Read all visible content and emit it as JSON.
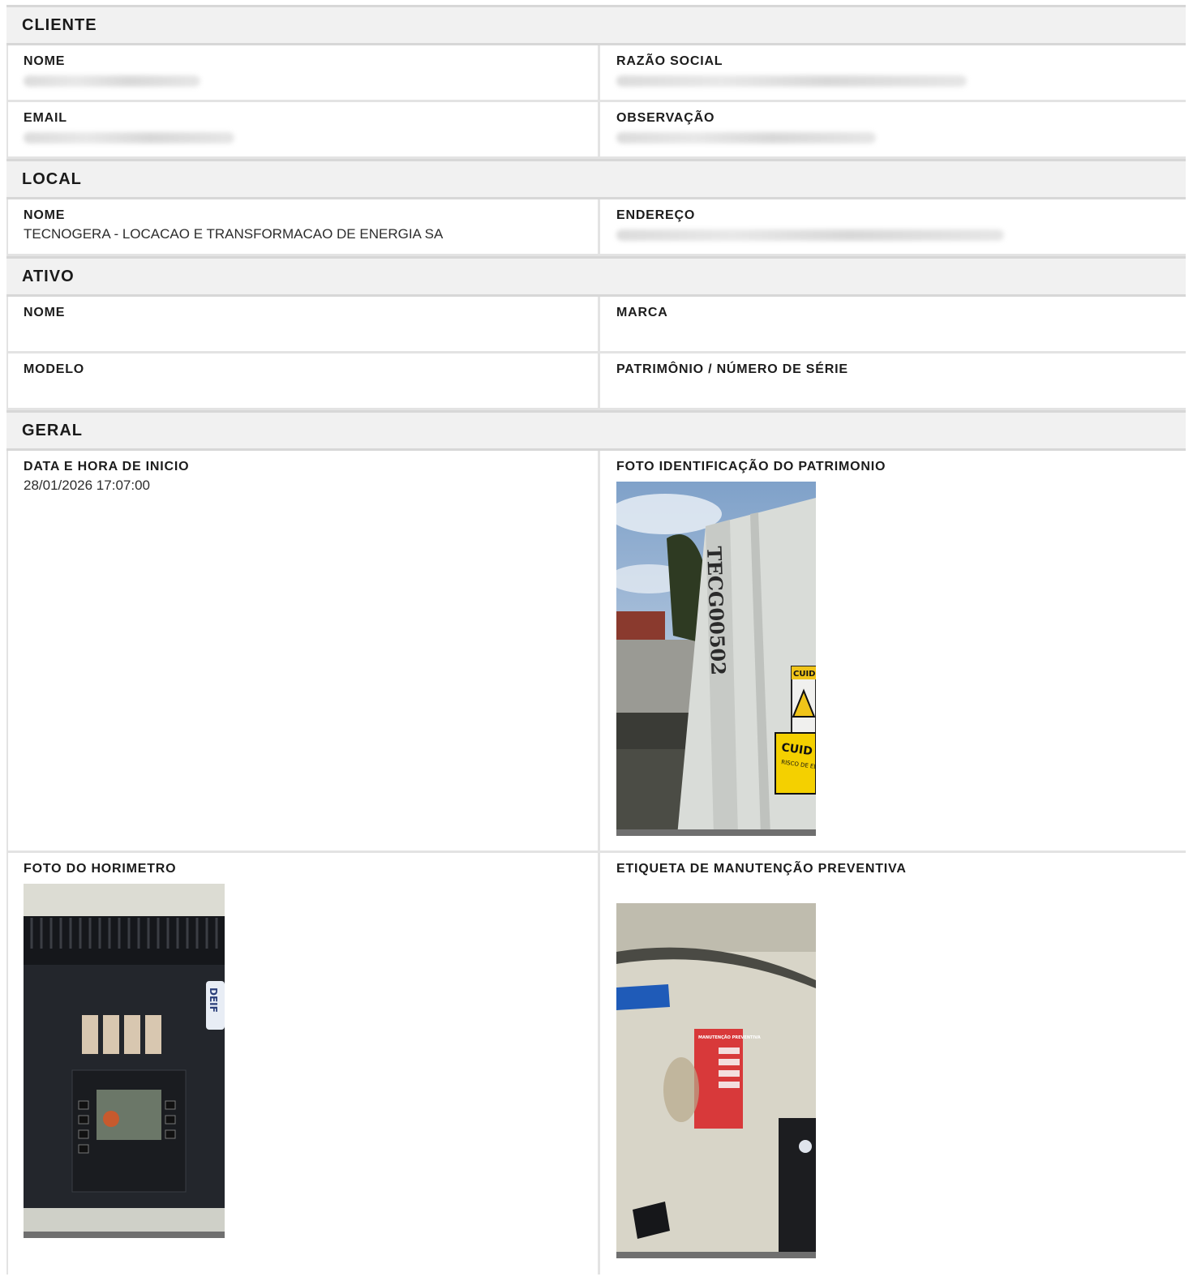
{
  "sections": {
    "cliente": {
      "title": "CLIENTE",
      "nome_label": "NOME",
      "razao_label": "RAZÃO SOCIAL",
      "email_label": "EMAIL",
      "obs_label": "OBSERVAÇÃO"
    },
    "local": {
      "title": "LOCAL",
      "nome_label": "NOME",
      "nome_value": "TECNOGERA - LOCACAO E TRANSFORMACAO DE ENERGIA SA",
      "endereco_label": "ENDEREÇO"
    },
    "ativo": {
      "title": "ATIVO",
      "nome_label": "NOME",
      "marca_label": "MARCA",
      "modelo_label": "MODELO",
      "patrimonio_label": "PATRIMÔNIO / NÚMERO DE SÉRIE"
    },
    "geral": {
      "title": "GERAL",
      "data_label": "DATA E HORA DE INICIO",
      "data_value": "28/01/2026 17:07:00",
      "foto_patrimonio_label": "FOTO IDENTIFICAÇÃO DO PATRIMONIO",
      "foto_horimetro_label": "FOTO DO HORIMETRO",
      "etiqueta_label": "ETIQUETA DE MANUTENÇÃO PREVENTIVA"
    }
  },
  "photos": {
    "patrimonio_text": "TECG00502",
    "sign_top": "CUID",
    "sign_bottom": "CUID",
    "sign_lines": "RISCO DE ELÉTR",
    "brand_text": "DEIF",
    "label_title": "MANUTENÇÃO PREVENTIVA"
  }
}
